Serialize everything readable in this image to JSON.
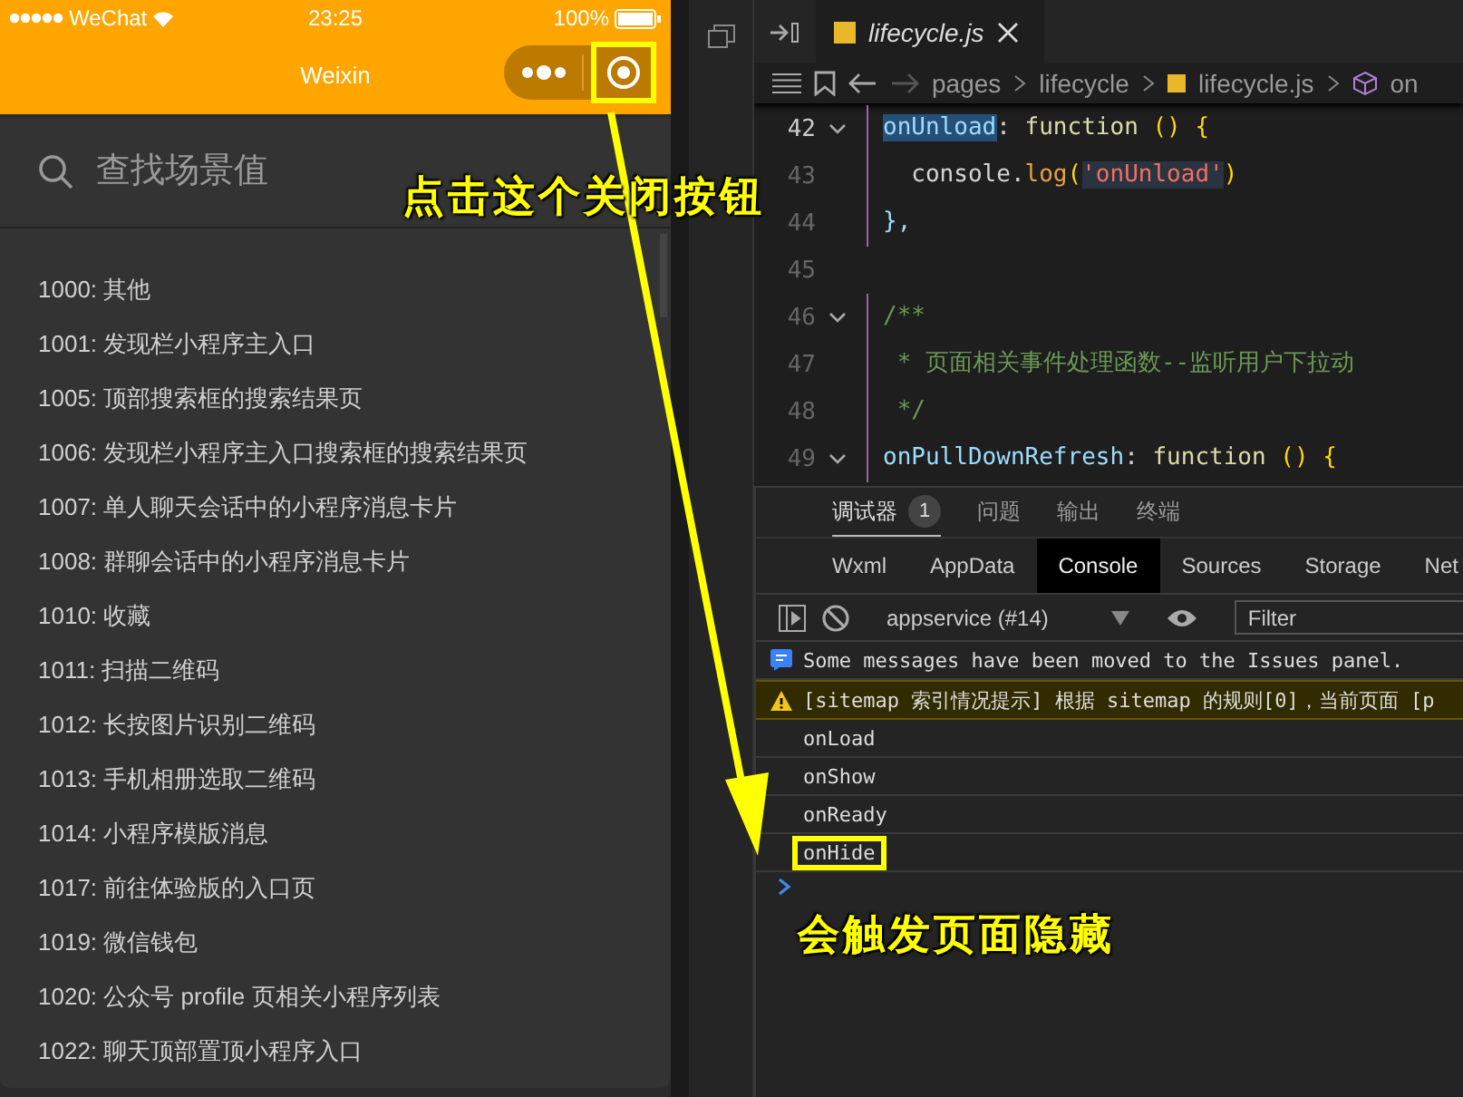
{
  "simulator": {
    "status_bar": {
      "carrier": "WeChat",
      "time": "23:25",
      "battery": "100%"
    },
    "nav": {
      "title": "Weixin",
      "close_highlighted": true
    },
    "search": {
      "placeholder": "查找场景值"
    },
    "scenes": [
      "1000: 其他",
      "1001: 发现栏小程序主入口",
      "1005: 顶部搜索框的搜索结果页",
      "1006: 发现栏小程序主入口搜索框的搜索结果页",
      "1007: 单人聊天会话中的小程序消息卡片",
      "1008: 群聊会话中的小程序消息卡片",
      "1010: 收藏",
      "1011: 扫描二维码",
      "1012: 长按图片识别二维码",
      "1013: 手机相册选取二维码",
      "1014: 小程序模版消息",
      "1017: 前往体验版的入口页",
      "1019: 微信钱包",
      "1020: 公众号 profile 页相关小程序列表",
      "1022: 聊天顶部置顶小程序入口"
    ]
  },
  "editor": {
    "tab": {
      "label": "lifecycle.js"
    },
    "breadcrumb": [
      {
        "kind": "folder",
        "label": "pages"
      },
      {
        "kind": "folder",
        "label": "lifecycle"
      },
      {
        "kind": "file",
        "label": "lifecycle.js"
      },
      {
        "kind": "symbol",
        "label": "on"
      }
    ],
    "lines": [
      {
        "number": "42",
        "foldable": true,
        "tokens": [
          {
            "kind": "key",
            "text": "onUnload"
          },
          {
            "kind": "plain",
            "text": ": "
          },
          {
            "kind": "kw",
            "text": "function"
          },
          {
            "kind": "brace",
            "text": " () {"
          }
        ]
      },
      {
        "number": "43",
        "foldable": false,
        "tokens": [
          {
            "kind": "plain",
            "text": "  console."
          },
          {
            "kind": "method",
            "text": "log"
          },
          {
            "kind": "brace",
            "text": "("
          },
          {
            "kind": "str",
            "text": "'onUnload'"
          },
          {
            "kind": "brace",
            "text": ")"
          }
        ]
      },
      {
        "number": "44",
        "foldable": false,
        "tokens": [
          {
            "kind": "punc",
            "text": "},"
          }
        ]
      },
      {
        "number": "45",
        "foldable": false
      },
      {
        "number": "46",
        "foldable": true,
        "tokens": [
          {
            "kind": "comment",
            "text": "/**"
          }
        ]
      },
      {
        "number": "47",
        "foldable": false,
        "tokens": [
          {
            "kind": "comment",
            "text": " * 页面相关事件处理函数--监听用户下拉动"
          }
        ]
      },
      {
        "number": "48",
        "foldable": false,
        "tokens": [
          {
            "kind": "comment",
            "text": " */"
          }
        ]
      },
      {
        "number": "49",
        "foldable": true,
        "tokens": [
          {
            "kind": "key2",
            "text": "onPullDownRefresh"
          },
          {
            "kind": "plain",
            "text": ": "
          },
          {
            "kind": "kw",
            "text": "function"
          },
          {
            "kind": "brace",
            "text": " () {"
          }
        ]
      }
    ]
  },
  "devtools": {
    "tabs": [
      {
        "label": "调试器",
        "selected": true,
        "badge": "1"
      },
      {
        "label": "问题",
        "selected": false
      },
      {
        "label": "输出",
        "selected": false
      },
      {
        "label": "终端",
        "selected": false
      }
    ],
    "panels": [
      {
        "label": "Wxml",
        "selected": false
      },
      {
        "label": "AppData",
        "selected": false
      },
      {
        "label": "Console",
        "selected": true
      },
      {
        "label": "Sources",
        "selected": false
      },
      {
        "label": "Storage",
        "selected": false
      },
      {
        "label": "Net",
        "selected": false
      }
    ],
    "context": "appservice (#14)",
    "filter": {
      "placeholder": "Filter"
    },
    "messages": [
      {
        "kind": "info",
        "text": "Some messages have been moved to the Issues panel."
      },
      {
        "kind": "warning",
        "text": "[sitemap 索引情况提示] 根据 sitemap 的规则[0]，当前页面 [p"
      },
      {
        "kind": "log",
        "text": "onLoad",
        "highlighted": false
      },
      {
        "kind": "log",
        "text": "onShow",
        "highlighted": false
      },
      {
        "kind": "log",
        "text": "onReady",
        "highlighted": false
      },
      {
        "kind": "log",
        "text": "onHide",
        "highlighted": true
      }
    ]
  },
  "annotations": [
    {
      "text": "点击这个关闭按钮"
    },
    {
      "text": "会触发页面隐藏"
    }
  ]
}
